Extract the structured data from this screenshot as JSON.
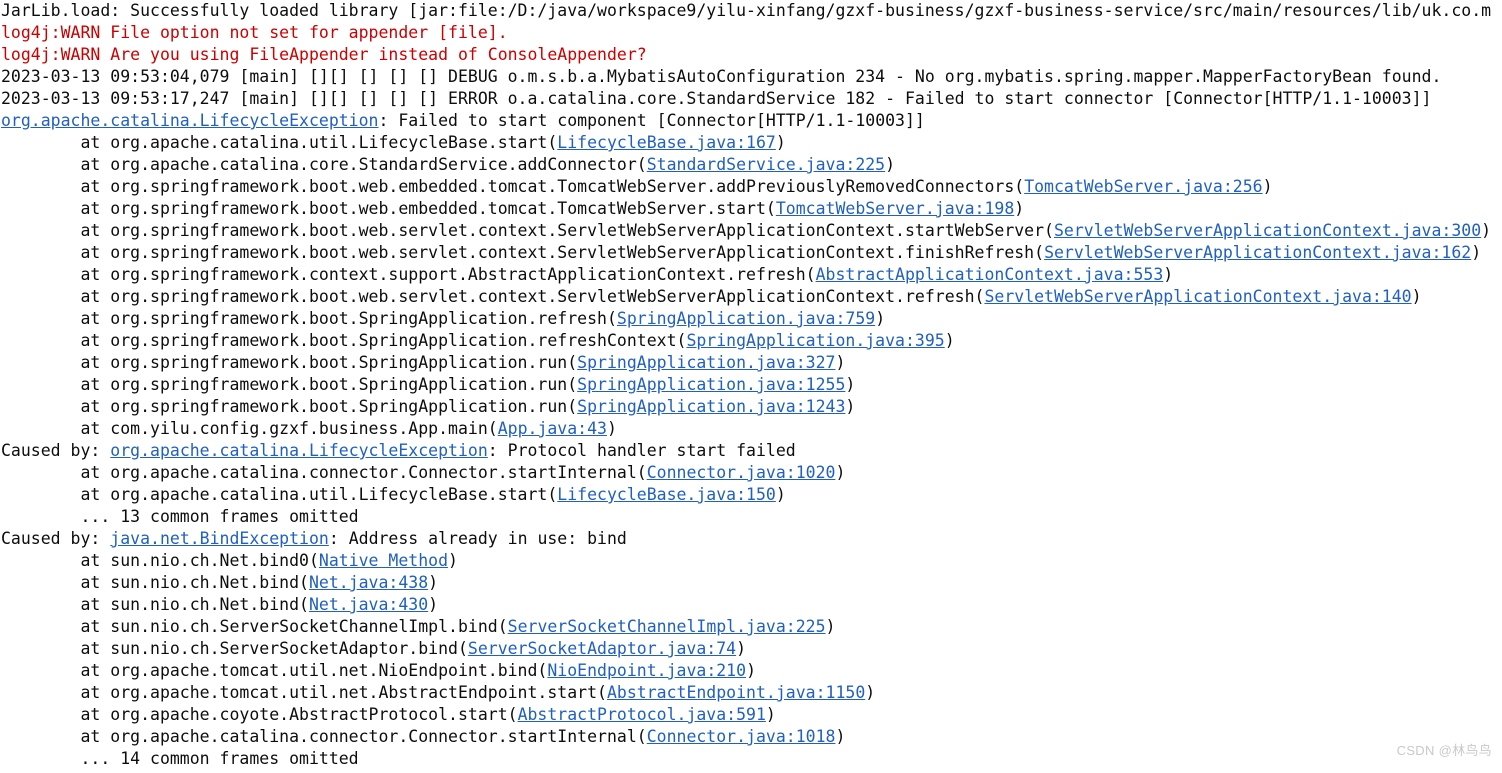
{
  "console": {
    "background_color": "#ffffff",
    "text_color": "#101010",
    "warn_color": "#cc0000",
    "link_color": "#2060c0",
    "lines": [
      {
        "kind": "plain",
        "segments": [
          {
            "type": "text",
            "text": "JarLib.load: Successfully loaded library [jar:file:/D:/java/workspace9/yilu-xinfang/gzxf-business/gzxf-business-service/src/main/resources/lib/uk.co.m"
          }
        ]
      },
      {
        "kind": "warn",
        "segments": [
          {
            "type": "text",
            "text": "log4j:WARN File option not set for appender [file]."
          }
        ]
      },
      {
        "kind": "warn",
        "segments": [
          {
            "type": "text",
            "text": "log4j:WARN Are you using FileAppender instead of ConsoleAppender?"
          }
        ]
      },
      {
        "kind": "plain",
        "segments": [
          {
            "type": "text",
            "text": "2023-03-13 09:53:04,079 [main] [][] [] [] [] DEBUG o.m.s.b.a.MybatisAutoConfiguration 234 - No org.mybatis.spring.mapper.MapperFactoryBean found."
          }
        ]
      },
      {
        "kind": "plain",
        "segments": [
          {
            "type": "text",
            "text": "2023-03-13 09:53:17,247 [main] [][] [] [] [] ERROR o.a.catalina.core.StandardService 182 - Failed to start connector [Connector[HTTP/1.1-10003]]"
          }
        ]
      },
      {
        "kind": "plain",
        "segments": [
          {
            "type": "exception-link",
            "text": "org.apache.catalina.LifecycleException"
          },
          {
            "type": "text",
            "text": ": Failed to start component [Connector[HTTP/1.1-10003]]"
          }
        ]
      },
      {
        "kind": "plain",
        "segments": [
          {
            "type": "text",
            "text": "        at org.apache.catalina.util.LifecycleBase.start("
          },
          {
            "type": "source-link",
            "text": "LifecycleBase.java:167"
          },
          {
            "type": "text",
            "text": ")"
          }
        ]
      },
      {
        "kind": "plain",
        "segments": [
          {
            "type": "text",
            "text": "        at org.apache.catalina.core.StandardService.addConnector("
          },
          {
            "type": "source-link",
            "text": "StandardService.java:225"
          },
          {
            "type": "text",
            "text": ")"
          }
        ]
      },
      {
        "kind": "plain",
        "segments": [
          {
            "type": "text",
            "text": "        at org.springframework.boot.web.embedded.tomcat.TomcatWebServer.addPreviouslyRemovedConnectors("
          },
          {
            "type": "source-link",
            "text": "TomcatWebServer.java:256"
          },
          {
            "type": "text",
            "text": ")"
          }
        ]
      },
      {
        "kind": "plain",
        "segments": [
          {
            "type": "text",
            "text": "        at org.springframework.boot.web.embedded.tomcat.TomcatWebServer.start("
          },
          {
            "type": "source-link",
            "text": "TomcatWebServer.java:198"
          },
          {
            "type": "text",
            "text": ")"
          }
        ]
      },
      {
        "kind": "plain",
        "segments": [
          {
            "type": "text",
            "text": "        at org.springframework.boot.web.servlet.context.ServletWebServerApplicationContext.startWebServer("
          },
          {
            "type": "source-link",
            "text": "ServletWebServerApplicationContext.java:300"
          },
          {
            "type": "text",
            "text": ")"
          }
        ]
      },
      {
        "kind": "plain",
        "segments": [
          {
            "type": "text",
            "text": "        at org.springframework.boot.web.servlet.context.ServletWebServerApplicationContext.finishRefresh("
          },
          {
            "type": "source-link",
            "text": "ServletWebServerApplicationContext.java:162"
          },
          {
            "type": "text",
            "text": ")"
          }
        ]
      },
      {
        "kind": "plain",
        "segments": [
          {
            "type": "text",
            "text": "        at org.springframework.context.support.AbstractApplicationContext.refresh("
          },
          {
            "type": "source-link",
            "text": "AbstractApplicationContext.java:553"
          },
          {
            "type": "text",
            "text": ")"
          }
        ]
      },
      {
        "kind": "plain",
        "segments": [
          {
            "type": "text",
            "text": "        at org.springframework.boot.web.servlet.context.ServletWebServerApplicationContext.refresh("
          },
          {
            "type": "source-link",
            "text": "ServletWebServerApplicationContext.java:140"
          },
          {
            "type": "text",
            "text": ")"
          }
        ]
      },
      {
        "kind": "plain",
        "segments": [
          {
            "type": "text",
            "text": "        at org.springframework.boot.SpringApplication.refresh("
          },
          {
            "type": "source-link",
            "text": "SpringApplication.java:759"
          },
          {
            "type": "text",
            "text": ")"
          }
        ]
      },
      {
        "kind": "plain",
        "segments": [
          {
            "type": "text",
            "text": "        at org.springframework.boot.SpringApplication.refreshContext("
          },
          {
            "type": "source-link",
            "text": "SpringApplication.java:395"
          },
          {
            "type": "text",
            "text": ")"
          }
        ]
      },
      {
        "kind": "plain",
        "segments": [
          {
            "type": "text",
            "text": "        at org.springframework.boot.SpringApplication.run("
          },
          {
            "type": "source-link",
            "text": "SpringApplication.java:327"
          },
          {
            "type": "text",
            "text": ")"
          }
        ]
      },
      {
        "kind": "plain",
        "segments": [
          {
            "type": "text",
            "text": "        at org.springframework.boot.SpringApplication.run("
          },
          {
            "type": "source-link",
            "text": "SpringApplication.java:1255"
          },
          {
            "type": "text",
            "text": ")"
          }
        ]
      },
      {
        "kind": "plain",
        "segments": [
          {
            "type": "text",
            "text": "        at org.springframework.boot.SpringApplication.run("
          },
          {
            "type": "source-link",
            "text": "SpringApplication.java:1243"
          },
          {
            "type": "text",
            "text": ")"
          }
        ]
      },
      {
        "kind": "plain",
        "segments": [
          {
            "type": "text",
            "text": "        at com.yilu.config.gzxf.business.App.main("
          },
          {
            "type": "source-link",
            "text": "App.java:43"
          },
          {
            "type": "text",
            "text": ")"
          }
        ]
      },
      {
        "kind": "plain",
        "segments": [
          {
            "type": "text",
            "text": "Caused by: "
          },
          {
            "type": "exception-link",
            "text": "org.apache.catalina.LifecycleException"
          },
          {
            "type": "text",
            "text": ": Protocol handler start failed"
          }
        ]
      },
      {
        "kind": "plain",
        "segments": [
          {
            "type": "text",
            "text": "        at org.apache.catalina.connector.Connector.startInternal("
          },
          {
            "type": "source-link",
            "text": "Connector.java:1020"
          },
          {
            "type": "text",
            "text": ")"
          }
        ]
      },
      {
        "kind": "plain",
        "segments": [
          {
            "type": "text",
            "text": "        at org.apache.catalina.util.LifecycleBase.start("
          },
          {
            "type": "source-link",
            "text": "LifecycleBase.java:150"
          },
          {
            "type": "text",
            "text": ")"
          }
        ]
      },
      {
        "kind": "plain",
        "segments": [
          {
            "type": "text",
            "text": "        ... 13 common frames omitted"
          }
        ]
      },
      {
        "kind": "plain",
        "segments": [
          {
            "type": "text",
            "text": "Caused by: "
          },
          {
            "type": "exception-link",
            "text": "java.net.BindException"
          },
          {
            "type": "text",
            "text": ": Address already in use: bind"
          }
        ]
      },
      {
        "kind": "plain",
        "segments": [
          {
            "type": "text",
            "text": "        at sun.nio.ch.Net.bind0("
          },
          {
            "type": "source-link",
            "text": "Native Method"
          },
          {
            "type": "text",
            "text": ")"
          }
        ]
      },
      {
        "kind": "plain",
        "segments": [
          {
            "type": "text",
            "text": "        at sun.nio.ch.Net.bind("
          },
          {
            "type": "source-link",
            "text": "Net.java:438"
          },
          {
            "type": "text",
            "text": ")"
          }
        ]
      },
      {
        "kind": "plain",
        "segments": [
          {
            "type": "text",
            "text": "        at sun.nio.ch.Net.bind("
          },
          {
            "type": "source-link",
            "text": "Net.java:430"
          },
          {
            "type": "text",
            "text": ")"
          }
        ]
      },
      {
        "kind": "plain",
        "segments": [
          {
            "type": "text",
            "text": "        at sun.nio.ch.ServerSocketChannelImpl.bind("
          },
          {
            "type": "source-link",
            "text": "ServerSocketChannelImpl.java:225"
          },
          {
            "type": "text",
            "text": ")"
          }
        ]
      },
      {
        "kind": "plain",
        "segments": [
          {
            "type": "text",
            "text": "        at sun.nio.ch.ServerSocketAdaptor.bind("
          },
          {
            "type": "source-link",
            "text": "ServerSocketAdaptor.java:74"
          },
          {
            "type": "text",
            "text": ")"
          }
        ]
      },
      {
        "kind": "plain",
        "segments": [
          {
            "type": "text",
            "text": "        at org.apache.tomcat.util.net.NioEndpoint.bind("
          },
          {
            "type": "source-link",
            "text": "NioEndpoint.java:210"
          },
          {
            "type": "text",
            "text": ")"
          }
        ]
      },
      {
        "kind": "plain",
        "segments": [
          {
            "type": "text",
            "text": "        at org.apache.tomcat.util.net.AbstractEndpoint.start("
          },
          {
            "type": "source-link",
            "text": "AbstractEndpoint.java:1150"
          },
          {
            "type": "text",
            "text": ")"
          }
        ]
      },
      {
        "kind": "plain",
        "segments": [
          {
            "type": "text",
            "text": "        at org.apache.coyote.AbstractProtocol.start("
          },
          {
            "type": "source-link",
            "text": "AbstractProtocol.java:591"
          },
          {
            "type": "text",
            "text": ")"
          }
        ]
      },
      {
        "kind": "plain",
        "segments": [
          {
            "type": "text",
            "text": "        at org.apache.catalina.connector.Connector.startInternal("
          },
          {
            "type": "source-link",
            "text": "Connector.java:1018"
          },
          {
            "type": "text",
            "text": ")"
          }
        ]
      },
      {
        "kind": "plain",
        "segments": [
          {
            "type": "text",
            "text": "        ... 14 common frames omitted"
          }
        ]
      }
    ]
  },
  "watermark": {
    "text": "CSDN @林鸟鸟"
  }
}
